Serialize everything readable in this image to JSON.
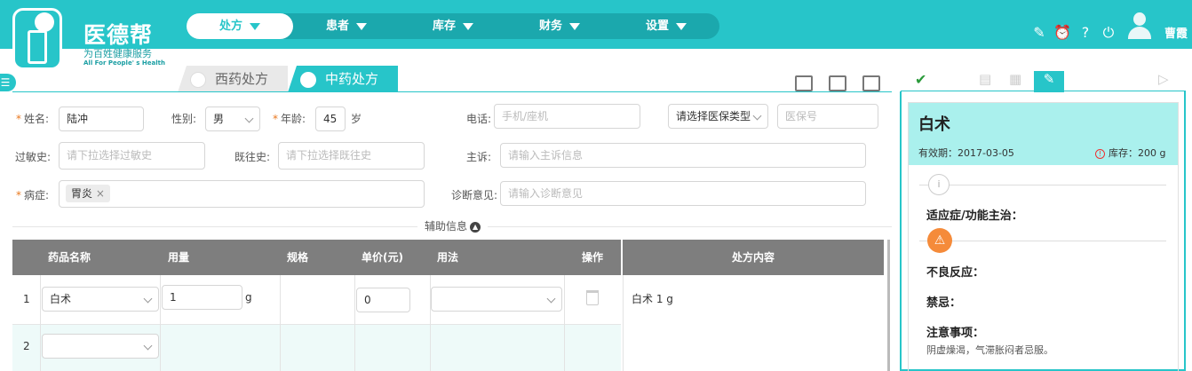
{
  "brand": {
    "name": "医德帮",
    "slogan": "为百姓健康服务",
    "slogan_en": "All For People' s Health"
  },
  "nav": [
    {
      "label": "处方",
      "active": true
    },
    {
      "label": "患者",
      "active": false
    },
    {
      "label": "库存",
      "active": false
    },
    {
      "label": "财务",
      "active": false
    },
    {
      "label": "设置",
      "active": false
    }
  ],
  "user": {
    "name": "曹霞"
  },
  "tabs": {
    "western": "西药处方",
    "chinese": "中药处方"
  },
  "form": {
    "name_label": "姓名:",
    "name_value": "陆冲",
    "gender_label": "性别:",
    "gender_value": "男",
    "age_label": "年龄:",
    "age_value": "45",
    "age_unit": "岁",
    "phone_label": "电话:",
    "phone_placeholder": "手机/座机",
    "insurance_type_placeholder": "请选择医保类型",
    "insurance_no_placeholder": "医保号",
    "allergy_label": "过敏史:",
    "allergy_placeholder": "请下拉选择过敏史",
    "history_label": "既往史:",
    "history_placeholder": "请下拉选择既往史",
    "complaint_label": "主诉:",
    "complaint_placeholder": "请输入主诉信息",
    "disease_label": "病症:",
    "disease_tag": "胃炎",
    "diagnosis_label": "诊断意见:",
    "diagnosis_placeholder": "请输入诊断意见",
    "aux_info": "辅助信息"
  },
  "table": {
    "headers": {
      "name": "药品名称",
      "dosage": "用量",
      "spec": "规格",
      "price": "单价(元)",
      "usage": "用法",
      "action": "操作"
    },
    "rows": [
      {
        "num": "1",
        "drug": "白术",
        "dosage": "1",
        "unit": "g",
        "price": "0"
      },
      {
        "num": "2",
        "drug": "",
        "dosage": "",
        "unit": "",
        "price": ""
      }
    ],
    "rx_header": "处方内容",
    "rx_content": "白术 1 g"
  },
  "drug_card": {
    "name": "白术",
    "expiry": "有效期：2017-03-05",
    "stock": "库存：200 g",
    "indication_label": "适应症/功能主治：",
    "adverse_label": "不良反应：",
    "contraindication_label": "禁忌：",
    "notes_label": "注意事项：",
    "notes_value": "阴虚燥渴，气滞胀闷者忌服。"
  },
  "colors": {
    "accent": "#27c5c9",
    "header_gray": "#7e7e7e",
    "card_head": "#aaf0ed",
    "warning": "#f58b3a"
  }
}
